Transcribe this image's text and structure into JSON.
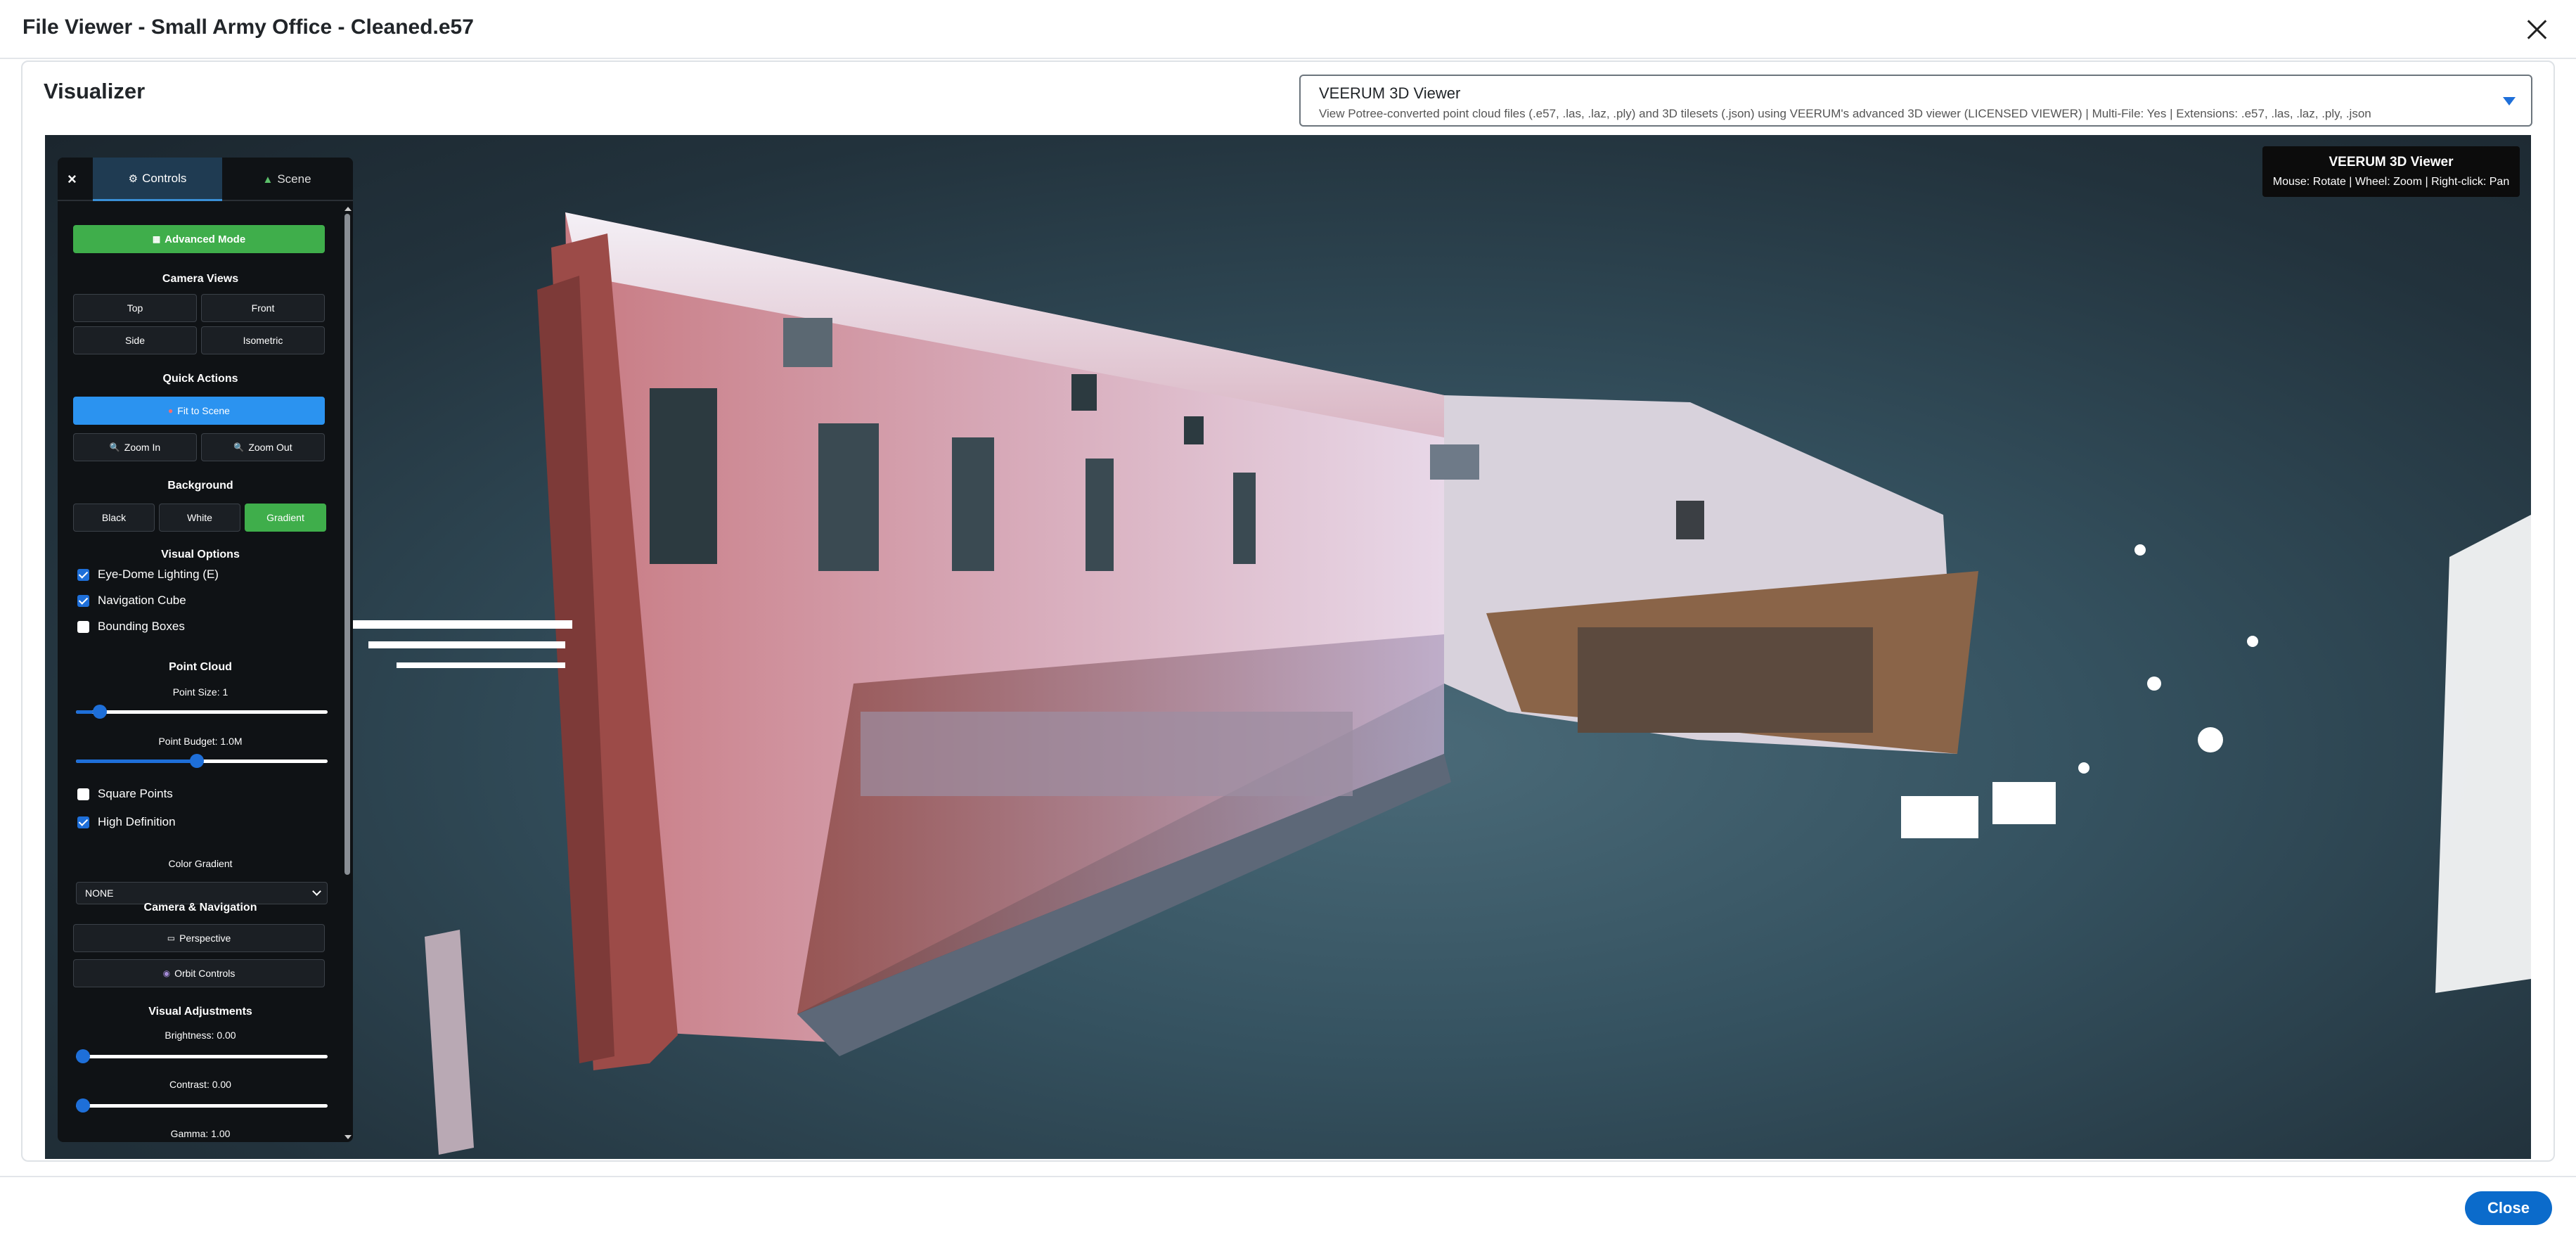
{
  "modal": {
    "title": "File Viewer - Small Army Office - Cleaned.e57",
    "close_icon": "close-icon"
  },
  "card": {
    "title": "Visualizer"
  },
  "viewer_select": {
    "name": "VEERUM 3D Viewer",
    "description": "View Potree-converted point cloud files (.e57, .las, .laz, .ply) and 3D tilesets (.json) using VEERUM's advanced 3D viewer (LICENSED VIEWER) | Multi-File: Yes | Extensions: .e57, .las, .laz, .ply, .json",
    "accent": "#1e6fd9"
  },
  "info_box": {
    "title": "VEERUM 3D Viewer",
    "help": "Mouse: Rotate | Wheel: Zoom | Right-click: Pan"
  },
  "panel": {
    "close_label": "×",
    "tabs": [
      {
        "label": "Controls",
        "icon": "gear-icon",
        "active": true
      },
      {
        "label": "Scene",
        "icon": "scene-icon",
        "active": false
      }
    ],
    "advanced_mode": "Advanced Mode",
    "camera_views": {
      "title": "Camera Views",
      "top": "Top",
      "front": "Front",
      "side": "Side",
      "isometric": "Isometric"
    },
    "quick_actions": {
      "title": "Quick Actions",
      "fit": "Fit to Scene",
      "zoom_in": "Zoom In",
      "zoom_out": "Zoom Out"
    },
    "background": {
      "title": "Background",
      "black": "Black",
      "white": "White",
      "gradient": "Gradient",
      "selected": "Gradient"
    },
    "visual_options": {
      "title": "Visual Options",
      "items": [
        {
          "label": "Eye-Dome Lighting (E)",
          "checked": true
        },
        {
          "label": "Navigation Cube",
          "checked": true
        },
        {
          "label": "Bounding Boxes",
          "checked": false
        }
      ]
    },
    "point_cloud": {
      "title": "Point Cloud",
      "point_size_label": "Point Size: 1",
      "point_size_level": 0.07,
      "point_budget_label": "Point Budget: 1.0M",
      "point_budget_level": 0.48,
      "square_points": {
        "label": "Square Points",
        "checked": false
      },
      "high_definition": {
        "label": "High Definition",
        "checked": true
      },
      "color_gradient_label": "Color Gradient",
      "color_gradient_value": "NONE"
    },
    "camera_nav": {
      "title": "Camera & Navigation",
      "perspective": "Perspective",
      "orbit": "Orbit Controls"
    },
    "visual_adjustments": {
      "title": "Visual Adjustments",
      "brightness_label": "Brightness: 0.00",
      "brightness_level": 0.0,
      "contrast_label": "Contrast: 0.00",
      "contrast_level": 0.0,
      "gamma_label": "Gamma: 1.00"
    }
  },
  "footer": {
    "close_label": "Close"
  }
}
